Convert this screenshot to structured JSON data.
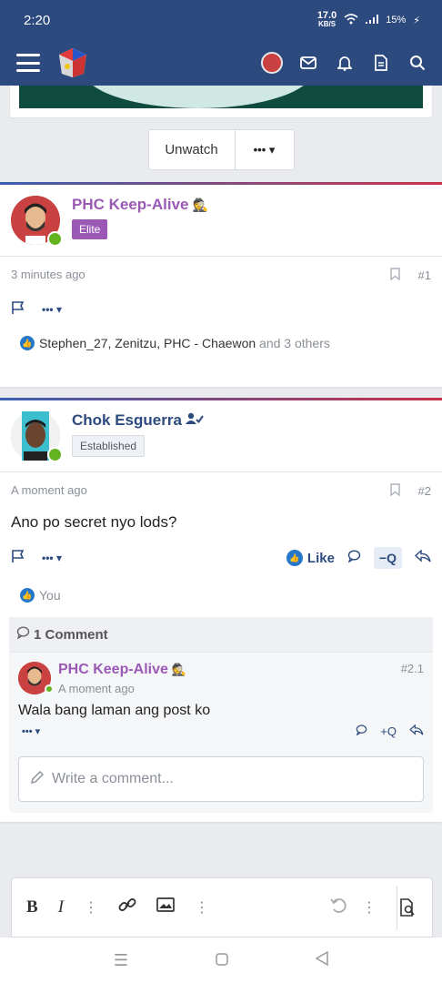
{
  "status": {
    "time": "2:20",
    "speed": "17.0",
    "speed_unit": "KB/S",
    "battery": "15%"
  },
  "header": {
    "icons": [
      "menu-icon",
      "site-logo",
      "user-avatar",
      "mail-icon",
      "bell-icon",
      "document-icon",
      "search-icon"
    ]
  },
  "thread": {
    "unwatch_label": "Unwatch",
    "more_label": "•••"
  },
  "post1": {
    "username": "PHC Keep-Alive",
    "badge": "Elite",
    "time": "3 minutes ago",
    "number": "#1",
    "reactions_names": "Stephen_27, Zenitzu, PHC - Chaewon",
    "reactions_others": "and 3 others"
  },
  "post2": {
    "username": "Chok Esguerra",
    "badge": "Established",
    "time": "A moment ago",
    "number": "#2",
    "body": "Ano po secret nyo lods?",
    "like_label": "Like",
    "quote_label": "−Q",
    "reactions_you": "You",
    "comments_title": "1 Comment",
    "comment": {
      "username": "PHC Keep-Alive",
      "time": "A moment ago",
      "number": "#2.1",
      "text": "Wala bang laman ang post ko",
      "quote_label": "+Q"
    },
    "write_placeholder": "Write a comment..."
  },
  "editor": {
    "bold": "B",
    "italic": "I"
  },
  "colors": {
    "brand": "#2c4a7e",
    "elite": "#9b59b6",
    "online": "#63b21f",
    "like": "#2577c9"
  }
}
